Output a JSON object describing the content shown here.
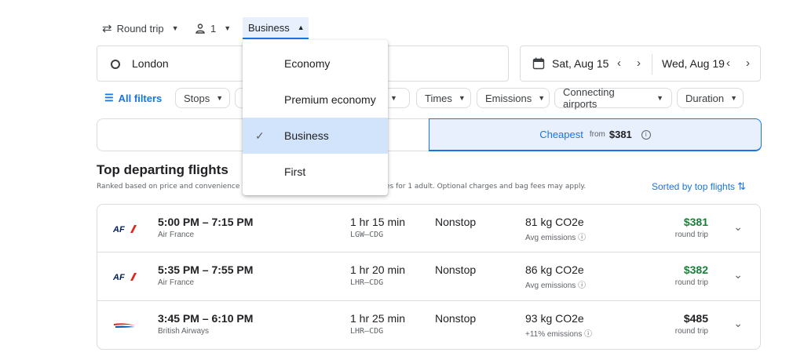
{
  "top_bar": {
    "trip_type": "Round trip",
    "passengers": "1",
    "cabin_class": "Business"
  },
  "search": {
    "origin": "London",
    "depart_date": "Sat, Aug 15",
    "return_date": "Wed, Aug 19"
  },
  "filters": {
    "all_filters": "All filters",
    "stops": "Stops",
    "airlines_hidden": "",
    "times": "Times",
    "emissions": "Emissions",
    "connecting_airports": "Connecting airports",
    "duration": "Duration"
  },
  "sort_tabs": {
    "cheapest_label": "Cheapest",
    "cheapest_from": "from",
    "cheapest_price": "$381"
  },
  "results": {
    "heading": "Top departing flights",
    "subheading_left": "Ranked based on price and convenience",
    "subheading_right": "es for 1 adult. Optional charges and bag fees may apply.",
    "sorted_by": "Sorted by top flights"
  },
  "flights": [
    {
      "time": "5:00 PM – 7:15 PM",
      "airline": "Air France",
      "duration": "1 hr 15 min",
      "route": "LGW–CDG",
      "stops": "Nonstop",
      "co2": "81 kg CO2e",
      "emissions": "Avg emissions",
      "price": "$381",
      "price_type": "round trip",
      "price_color": "#188038"
    },
    {
      "time": "5:35 PM – 7:55 PM",
      "airline": "Air France",
      "duration": "1 hr 20 min",
      "route": "LHR–CDG",
      "stops": "Nonstop",
      "co2": "86 kg CO2e",
      "emissions": "Avg emissions",
      "price": "$382",
      "price_type": "round trip",
      "price_color": "#188038"
    },
    {
      "time": "3:45 PM – 6:10 PM",
      "airline": "British Airways",
      "duration": "1 hr 25 min",
      "route": "LHR–CDG",
      "stops": "Nonstop",
      "co2": "93 kg CO2e",
      "emissions": "+11% emissions",
      "price": "$485",
      "price_type": "round trip",
      "price_color": "#202124"
    }
  ],
  "cabin_dropdown": {
    "options": [
      "Economy",
      "Premium economy",
      "Business",
      "First"
    ],
    "selected": "Business"
  },
  "colors": {
    "accent": "#1a73e8",
    "selected_bg": "#d2e3fc",
    "airfrance_red": "#e1251b",
    "airfrance_navy": "#002157"
  }
}
